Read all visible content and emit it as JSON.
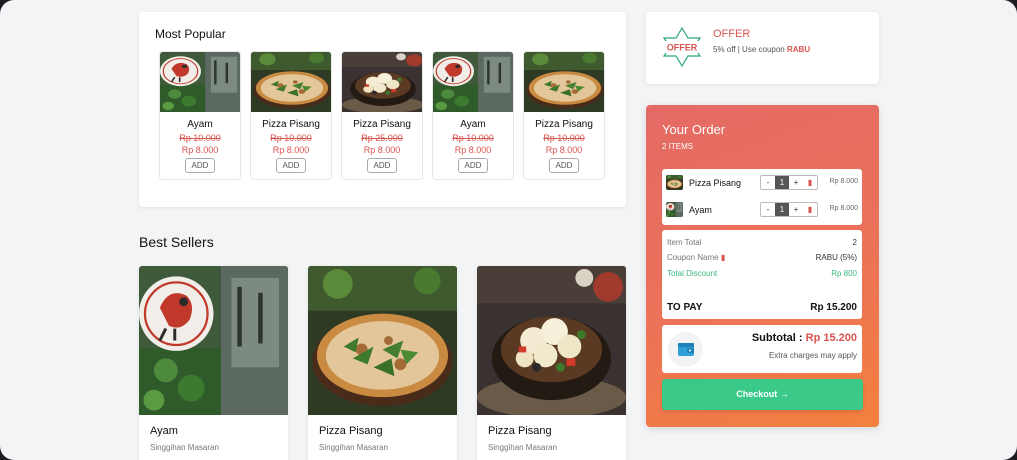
{
  "popular": {
    "title": "Most Popular",
    "add_label": "ADD",
    "items": [
      {
        "name": "Ayam",
        "old_price": "Rp 10.000",
        "new_price": "Rp 8.000",
        "image": "restaurant-sign"
      },
      {
        "name": "Pizza Pisang",
        "old_price": "Rp 10.000",
        "new_price": "Rp 8.000",
        "image": "pizza"
      },
      {
        "name": "Pizza Pisang",
        "old_price": "Rp 25.000",
        "new_price": "Rp 8.000",
        "image": "cauliflower-bowl"
      },
      {
        "name": "Ayam",
        "old_price": "Rp 10.000",
        "new_price": "Rp 8.000",
        "image": "restaurant-sign"
      },
      {
        "name": "Pizza Pisang",
        "old_price": "Rp 10.000",
        "new_price": "Rp 8.000",
        "image": "pizza"
      }
    ]
  },
  "best_sellers": {
    "title": "Best Sellers",
    "items": [
      {
        "name": "Ayam",
        "restaurant": "Singgihan Masaran",
        "image": "restaurant-sign"
      },
      {
        "name": "Pizza Pisang",
        "restaurant": "Singgihan Masaran",
        "image": "pizza"
      },
      {
        "name": "Pizza Pisang",
        "restaurant": "Singgihan Masaran",
        "image": "cauliflower-bowl"
      }
    ]
  },
  "offer": {
    "icon": "offer-star-badge",
    "badge_text": "OFFER",
    "title": "OFFER",
    "desc_prefix": "5% off | Use coupon ",
    "coupon": "RABU"
  },
  "order": {
    "title": "Your Order",
    "count": "2 ITEMS",
    "items": [
      {
        "name": "Pizza Pisang",
        "qty": "1",
        "price": "Rp 8.000",
        "minus": "-",
        "plus": "+",
        "image": "pizza"
      },
      {
        "name": "Ayam",
        "qty": "1",
        "price": "Rp 8.000",
        "minus": "-",
        "plus": "+",
        "image": "restaurant-sign"
      }
    ],
    "summary": {
      "item_total_label": "Item Total",
      "item_total_value": "2",
      "coupon_label": "Coupon Name",
      "coupon_value": "RABU (5%)",
      "discount_label": "Total Discount",
      "discount_value": "Rp 800",
      "to_pay_label": "TO PAY",
      "to_pay_value": "Rp 15.200"
    },
    "subtotal_label": "Subtotal : ",
    "subtotal_value": "Rp 15.200",
    "extra_note": "Extra charges may apply",
    "checkout_label": "Checkout →"
  },
  "colors": {
    "accent_red": "#d9534f",
    "checkout_green": "#3bc98a",
    "order_gradient_start": "#e46a66",
    "order_gradient_end": "#f4803d"
  }
}
